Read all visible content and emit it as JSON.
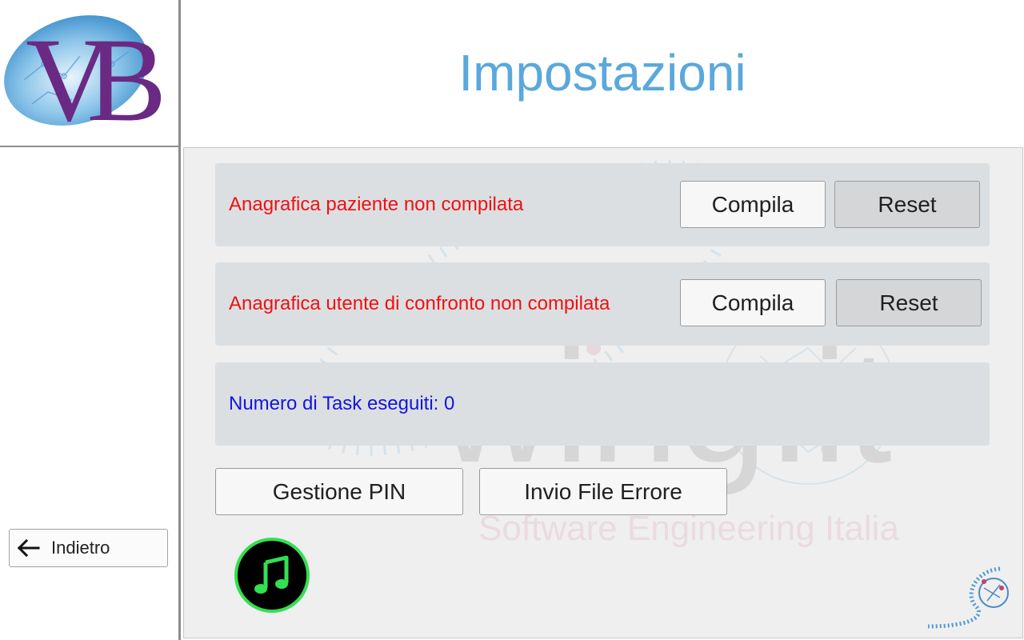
{
  "header": {
    "title": "Impostazioni",
    "logo_text": "VB"
  },
  "sidebar": {
    "back_label": "Indietro"
  },
  "main": {
    "rows": [
      {
        "label": "Anagrafica paziente non compilata",
        "compile_label": "Compila",
        "reset_label": "Reset"
      },
      {
        "label": "Anagrafica utente di confronto non compilata",
        "compile_label": "Compila",
        "reset_label": "Reset"
      },
      {
        "label": "Numero di Task eseguiti: 0"
      }
    ],
    "buttons": {
      "pin_label": "Gestione PIN",
      "error_file_label": "Invio File Errore"
    },
    "watermark": {
      "brand": "wing.it",
      "tagline": "Software Engineering Italia"
    }
  },
  "icons": {
    "back": "arrow-left-icon",
    "music": "music-note-icon",
    "corner_logo": "wing-logo-icon"
  },
  "colors": {
    "title": "#5aa8dc",
    "warning_text": "#f01010",
    "info_text": "#1414e0",
    "music_ring": "#33e050"
  }
}
